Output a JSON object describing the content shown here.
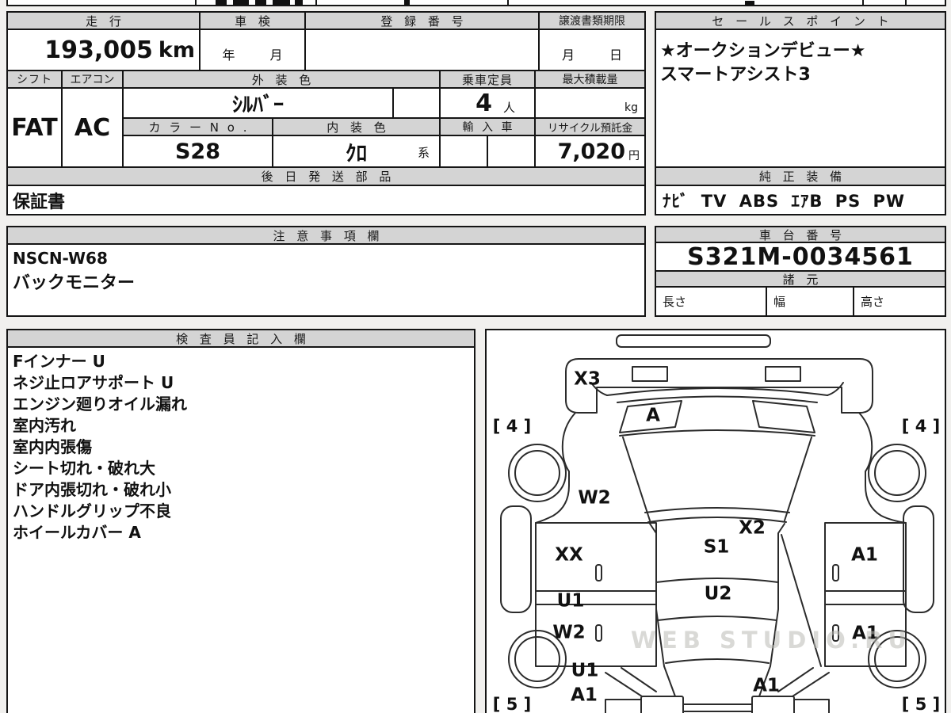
{
  "top_table": {
    "mileage_header": "走 行",
    "inspection_header": "車 検",
    "registration_header": "登 録 番 号",
    "transfer_docs_header": "譲渡書類期限",
    "mileage_value": "193,005",
    "mileage_unit": "km",
    "inspection_year_label": "年",
    "inspection_month_label": "月",
    "transfer_month_label": "月",
    "transfer_day_label": "日",
    "shift_header": "シフト",
    "aircon_header": "エアコン",
    "exterior_color_header": "外 装 色",
    "capacity_header": "乗車定員",
    "max_load_header": "最大積載量",
    "shift_value": "FAT",
    "aircon_value": "AC",
    "exterior_color_value": "ｼﾙﾊﾞｰ",
    "capacity_value": "4",
    "capacity_unit": "人",
    "max_load_unit": "kg",
    "color_no_header": "カ ラ ー N o .",
    "interior_color_header": "内 装 色",
    "import_header": "輸 入 車",
    "recycle_header": "リサイクル預託金",
    "color_no_value": "S28",
    "interior_color_value": "ｸﾛ",
    "interior_color_group": "系",
    "recycle_value": "7,020",
    "recycle_unit": "円",
    "later_parts_header": "後 日 発 送 部 品",
    "later_parts_value": "保証書"
  },
  "sales_points": {
    "header": "セ ー ル ス ポ イ ン ト",
    "line1": "★オークションデビュー★",
    "line2": "スマートアシスト3",
    "equipment_header": "純 正 装 備",
    "equipment_value": "ﾅﾋﾞ TV ABS ｴｱB PS PW"
  },
  "cautions": {
    "header": "注 意 事 項 欄",
    "line1": "NSCN-W68",
    "line2": "バックモニター"
  },
  "chassis": {
    "header": "車 台 番 号",
    "value": "S321M-0034561",
    "specs_header": "諸 元",
    "length_label": "長さ",
    "width_label": "幅",
    "height_label": "高さ"
  },
  "inspector": {
    "header": "検 査 員 記 入 欄",
    "lines": [
      "Fインナー U",
      "ネジ止ロアサポート U",
      "エンジン廻りオイル漏れ",
      "室内汚れ",
      "室内内張傷",
      "シート切れ・破れ大",
      "ドア内張切れ・破れ小",
      "ハンドルグリップ不良",
      "ホイールカバー A"
    ]
  },
  "diagram": {
    "labels": {
      "front_panel": "X3",
      "windshield": "A",
      "tire_front_left": "[ 4 ]",
      "tire_front_right": "[ 4 ]",
      "fender_left": "W2",
      "dash": "X2",
      "door_left_front": "XX",
      "roof_front": "S1",
      "door_right_front": "A1",
      "panel_left_mid": "U1",
      "roof_mid": "U2",
      "panel_left_lower": "W2",
      "door_right_rear": "A1",
      "quarter_left": "U1",
      "rear_gate": "A1",
      "quarter_left_lower": "A1",
      "tire_rear_left": "[ 5 ]",
      "tire_rear_right": "[ 5 ]"
    },
    "watermark": "WEB STUDIO.RU"
  }
}
